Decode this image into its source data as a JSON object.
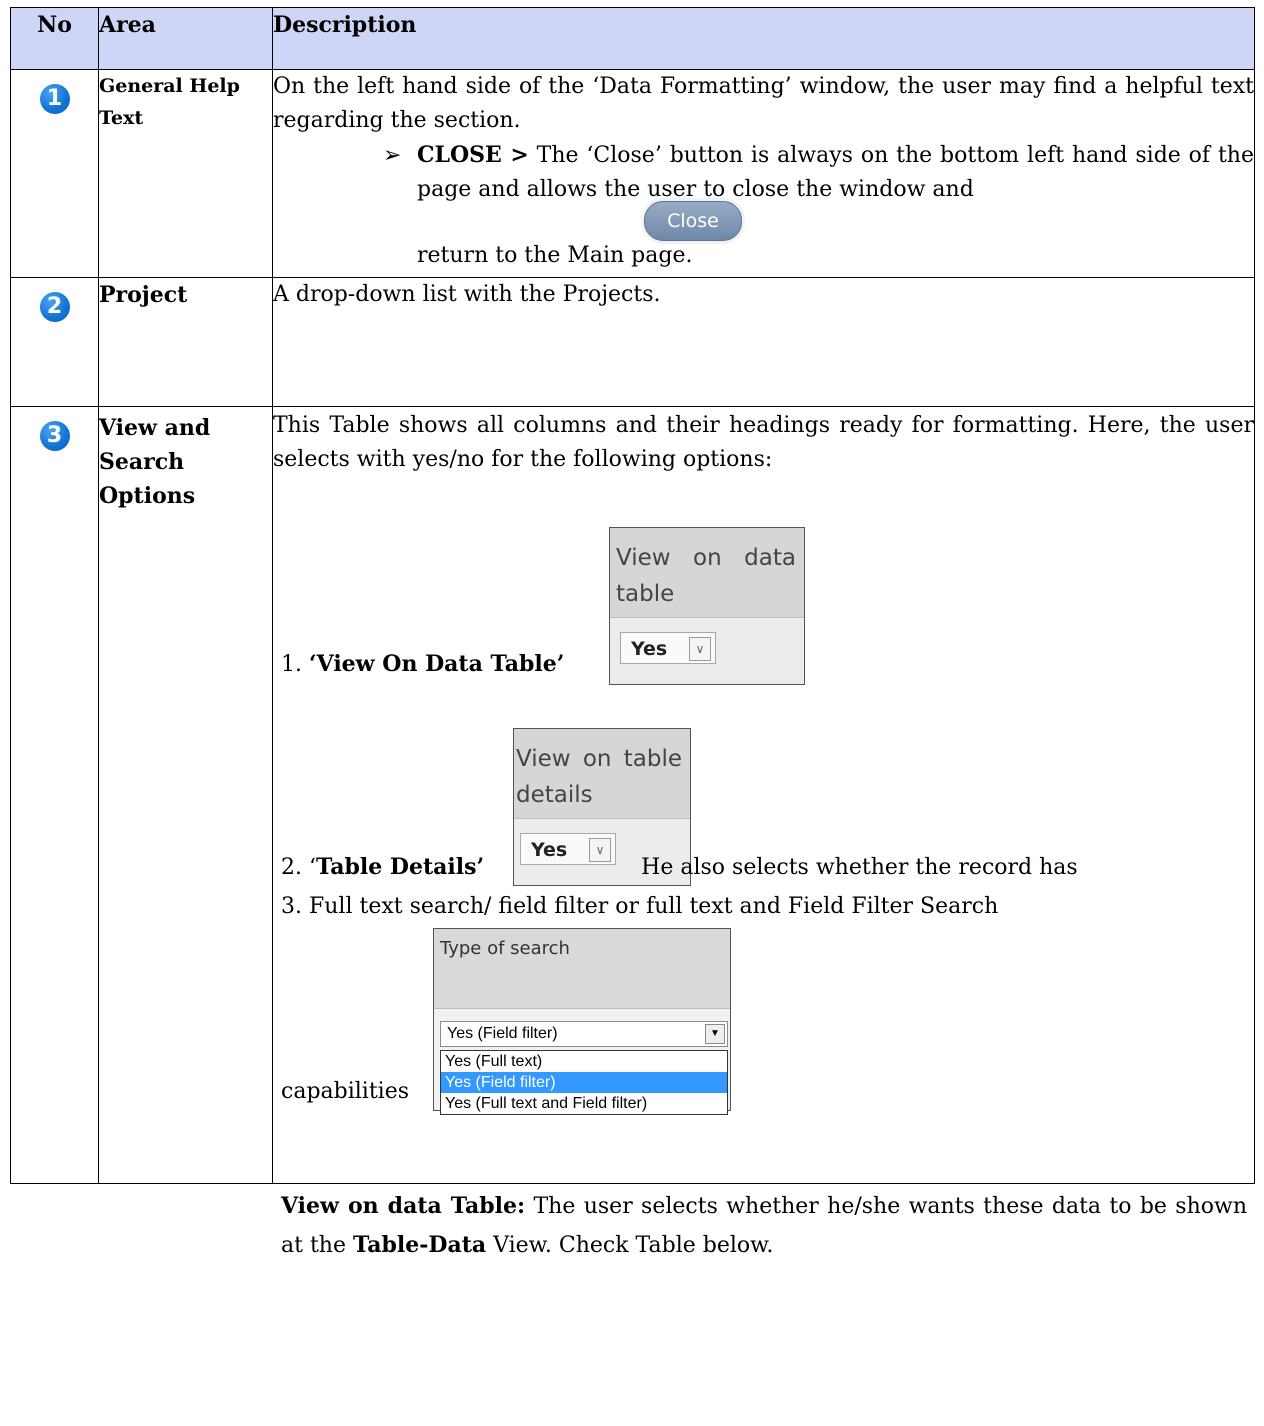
{
  "header": {
    "no": "No",
    "area": "Area",
    "description": "Description"
  },
  "rows": [
    {
      "num": "1",
      "area": "General Help Text",
      "text": "On the left hand side of the ‘Data Formatting’ window, the user may find a helpful text regarding the section.",
      "bullet_arrow": "➢",
      "bullet_bold": "CLOSE >",
      "bullet_text": " The ‘Close’ button is always on the bottom left hand side of the page and allows the user to close the window and",
      "return_text": "return to the Main page.",
      "close_button": "Close"
    },
    {
      "num": "2",
      "area": "Project",
      "text": "A drop-down list with the Projects."
    },
    {
      "num": "3",
      "area": "View and Search Options",
      "intro": "This Table shows all columns and their headings ready for formatting. Here, the user selects with yes/no for the following options:",
      "opt1_prefix": "1. ",
      "opt1_bold": "‘View On Data Table’",
      "shot1_head": "View on data table",
      "shot1_value": "Yes",
      "opt2_prefix": "2. ‘",
      "opt2_bold": "Table Details’",
      "opt2_after": " He also selects whether the record has",
      "shot2_head": "View on table details",
      "shot2_value": "Yes",
      "opt3": "3. Full text search/ field filter or full text and Field Filter Search",
      "shot3_head": "Type of search",
      "shot3_selected": "Yes (Field filter)",
      "shot3_options": [
        "Yes (Full text)",
        "Yes (Field filter)",
        "Yes (Full text and Field filter)"
      ],
      "capabilities": "capabilities",
      "note_bold1": "View on data Table:",
      "note_text1": " The user selects whether he/she wants these data to be shown at the ",
      "note_bold2": "Table-Data",
      "note_text2": " View. Check Table below."
    }
  ],
  "colors": {
    "header_bg": "#cfd5f7",
    "bullet": "#1576d6",
    "highlight": "#3399ff"
  }
}
